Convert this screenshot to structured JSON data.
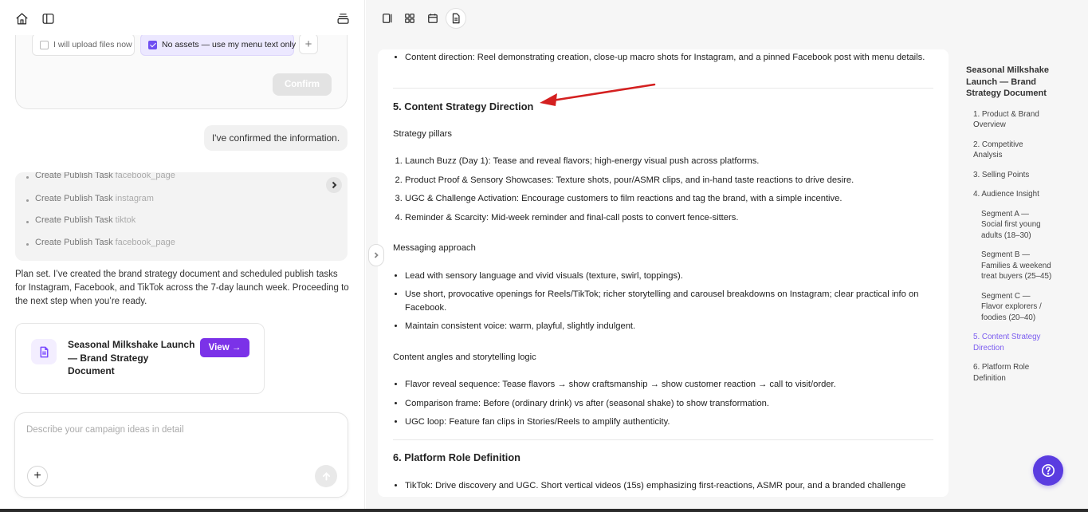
{
  "left": {
    "options": {
      "upload_label": "I will upload files now",
      "menu_text_label": "No assets — use my menu text only",
      "add_symbol": "+"
    },
    "confirm_label": "Confirm",
    "user_message": "I've confirmed the information.",
    "tasks": {
      "partial": {
        "label": "Create Publish Task",
        "target": "facebook_page"
      },
      "items": [
        {
          "label": "Create Publish Task",
          "target": "instagram"
        },
        {
          "label": "Create Publish Task",
          "target": "tiktok"
        },
        {
          "label": "Create Publish Task",
          "target": "facebook_page"
        }
      ]
    },
    "plan_text": "Plan set. I’ve created the brand strategy document and scheduled publish tasks for Instagram, Facebook, and TikTok across the 7-day launch week. Proceeding to the next step when you’re ready.",
    "doc_card": {
      "title": "Seasonal Milkshake Launch — Brand Strategy Document",
      "view_label": "View →"
    },
    "composer": {
      "placeholder": "Describe your campaign ideas in detail",
      "add_symbol": "+"
    }
  },
  "doc": {
    "top_bullet": "Content direction: Reel demonstrating creation, close-up macro shots for Instagram, and a pinned Facebook post with menu details.",
    "section5": {
      "heading": "5. Content Strategy Direction",
      "pillars_title": "Strategy pillars",
      "pillars": [
        "Launch Buzz (Day 1): Tease and reveal flavors; high-energy visual push across platforms.",
        "Product Proof & Sensory Showcases: Texture shots, pour/ASMR clips, and in-hand taste reactions to drive desire.",
        "UGC & Challenge Activation: Encourage customers to film reactions and tag the brand, with a simple incentive.",
        "Reminder & Scarcity: Mid-week reminder and final-call posts to convert fence-sitters."
      ],
      "messaging_title": "Messaging approach",
      "messaging": [
        "Lead with sensory language and vivid visuals (texture, swirl, toppings).",
        "Use short, provocative openings for Reels/TikTok; richer storytelling and carousel breakdowns on Instagram; clear practical info on Facebook.",
        "Maintain consistent voice: warm, playful, slightly indulgent."
      ],
      "angles_title": "Content angles and storytelling logic",
      "angles": [
        "Flavor reveal sequence: Tease flavors → show craftsmanship → show customer reaction → call to visit/order.",
        "Comparison frame: Before (ordinary drink) vs after (seasonal shake) to show transformation.",
        "UGC loop: Feature fan clips in Stories/Reels to amplify authenticity."
      ]
    },
    "section6": {
      "heading": "6. Platform Role Definition",
      "bullets": [
        "TikTok: Drive discovery and UGC. Short vertical videos (15s) emphasizing first-reactions, ASMR pour, and a branded challenge"
      ]
    }
  },
  "toc": {
    "title": "Seasonal Milkshake Launch — Brand Strategy Document",
    "items": [
      {
        "label": "1. Product & Brand Overview"
      },
      {
        "label": "2. Competitive Analysis"
      },
      {
        "label": "3. Selling Points"
      },
      {
        "label": "4. Audience Insight"
      },
      {
        "label": "Segment A — Social first young adults (18–30)"
      },
      {
        "label": "Segment B — Families & weekend treat buyers (25–45)"
      },
      {
        "label": "Segment C — Flavor explorers / foodies (20–40)"
      },
      {
        "label": "5. Content Strategy Direction"
      },
      {
        "label": "6. Platform Role Definition"
      }
    ],
    "active_index": 7
  },
  "colors": {
    "accent": "#7b32e8",
    "toc_active": "#7b5cf0",
    "help_button": "#5a3ce0",
    "annotation_arrow": "#d42020"
  },
  "icons": [
    "home-icon",
    "sidebar-toggle-icon",
    "stack-icon",
    "split-view-icon",
    "grid-icon",
    "calendar-icon",
    "document-icon",
    "help-icon",
    "chevron-right-icon",
    "arrow-up-icon",
    "file-icon"
  ]
}
